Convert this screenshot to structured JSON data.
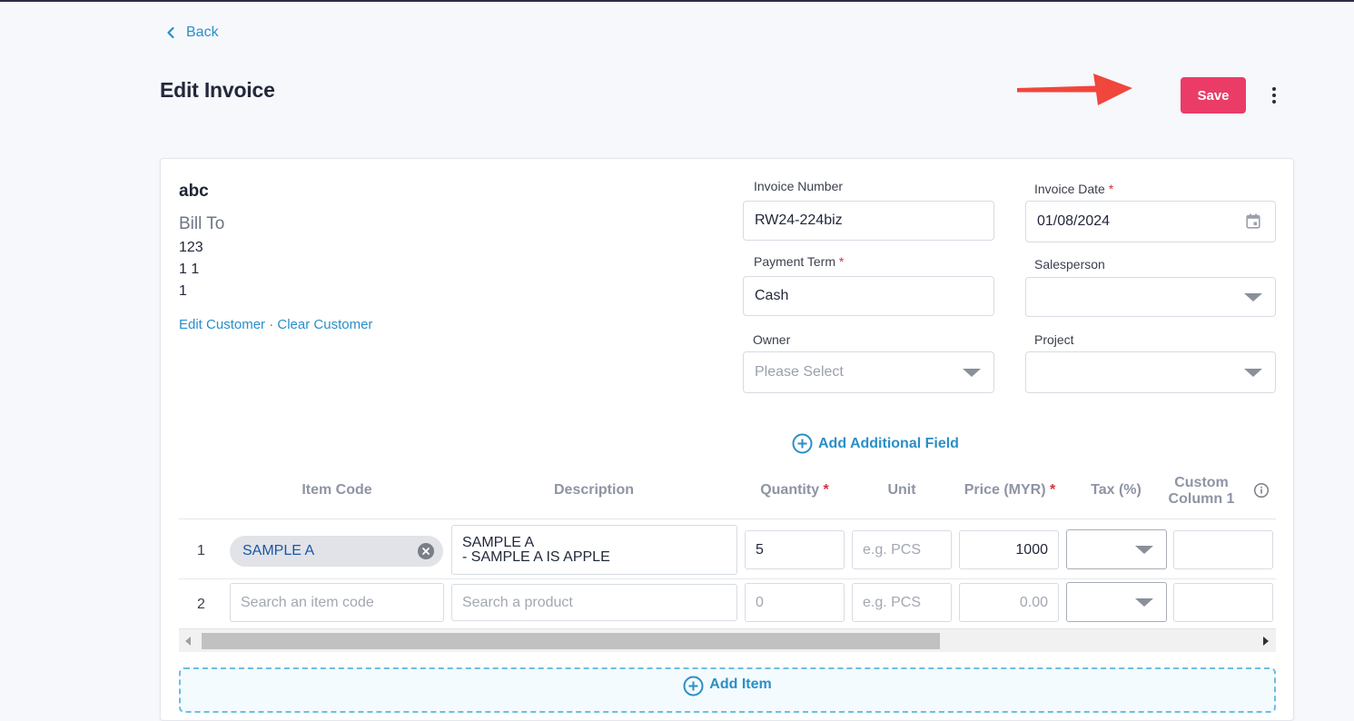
{
  "nav": {
    "back_label": "Back"
  },
  "header": {
    "title": "Edit Invoice",
    "save_label": "Save"
  },
  "customer": {
    "name": "abc",
    "bill_to_label": "Bill To",
    "address_lines": [
      "123",
      "1 1",
      "1"
    ],
    "edit_link": "Edit Customer",
    "separator": "·",
    "clear_link": "Clear Customer"
  },
  "form": {
    "invoice_number": {
      "label": "Invoice Number",
      "value": "RW24-224biz"
    },
    "invoice_date": {
      "label": "Invoice Date",
      "required": "*",
      "value": "01/08/2024"
    },
    "payment_term": {
      "label": "Payment Term",
      "required": "*",
      "value": "Cash"
    },
    "salesperson": {
      "label": "Salesperson",
      "value": ""
    },
    "owner": {
      "label": "Owner",
      "placeholder": "Please Select"
    },
    "project": {
      "label": "Project",
      "value": ""
    },
    "add_field_label": "Add Additional Field"
  },
  "table": {
    "headers": {
      "item_code": "Item Code",
      "description": "Description",
      "quantity": "Quantity",
      "quantity_req": "*",
      "unit": "Unit",
      "price": "Price (MYR)",
      "price_req": "*",
      "tax": "Tax (%)",
      "custom1_line1": "Custom",
      "custom1_line2": "Column 1"
    },
    "rows": [
      {
        "num": "1",
        "item_code": "SAMPLE A",
        "description_line1": "SAMPLE A",
        "description_line2": "- SAMPLE A IS APPLE",
        "quantity": "5",
        "unit_placeholder": "e.g. PCS",
        "price": "1000"
      },
      {
        "num": "2",
        "item_code_placeholder": "Search an item code",
        "description_placeholder": "Search a product",
        "quantity_placeholder": "0",
        "unit_placeholder": "e.g. PCS",
        "price_placeholder": "0.00"
      }
    ],
    "add_item_label": "Add Item"
  },
  "colors": {
    "accent": "#2a8fc7",
    "save": "#ea3c66",
    "arrow": "#f0463c"
  }
}
